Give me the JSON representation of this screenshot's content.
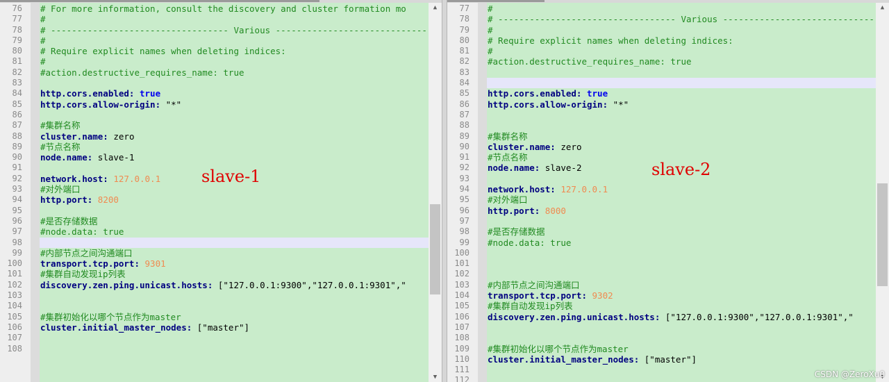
{
  "left_pane": {
    "annotation": "slave-1",
    "lines": [
      {
        "n": "76",
        "segs": [
          [
            "comment",
            "# For more information, consult the discovery and cluster formation mo"
          ]
        ]
      },
      {
        "n": "77",
        "segs": [
          [
            "comment",
            "#"
          ]
        ]
      },
      {
        "n": "78",
        "segs": [
          [
            "comment",
            "# ---------------------------------- Various -----------------------------------"
          ]
        ]
      },
      {
        "n": "79",
        "segs": [
          [
            "comment",
            "#"
          ]
        ]
      },
      {
        "n": "80",
        "segs": [
          [
            "comment",
            "# Require explicit names when deleting indices:"
          ]
        ]
      },
      {
        "n": "81",
        "segs": [
          [
            "comment",
            "#"
          ]
        ]
      },
      {
        "n": "82",
        "segs": [
          [
            "comment",
            "#action.destructive_requires_name: true"
          ]
        ]
      },
      {
        "n": "83",
        "segs": []
      },
      {
        "n": "84",
        "segs": [
          [
            "key",
            "http.cors.enabled:"
          ],
          [
            "plain",
            " "
          ],
          [
            "bool",
            "true"
          ]
        ]
      },
      {
        "n": "85",
        "segs": [
          [
            "key",
            "http.cors.allow-origin:"
          ],
          [
            "str",
            " \"*\""
          ]
        ]
      },
      {
        "n": "86",
        "segs": []
      },
      {
        "n": "87",
        "segs": [
          [
            "comment",
            "#集群名称"
          ]
        ]
      },
      {
        "n": "88",
        "segs": [
          [
            "key",
            "cluster.name:"
          ],
          [
            "plain",
            " zero"
          ]
        ]
      },
      {
        "n": "89",
        "segs": [
          [
            "comment",
            "#节点名称"
          ]
        ]
      },
      {
        "n": "90",
        "segs": [
          [
            "key",
            "node.name:"
          ],
          [
            "plain",
            " slave-1"
          ]
        ]
      },
      {
        "n": "91",
        "segs": []
      },
      {
        "n": "92",
        "segs": [
          [
            "key",
            "network.host:"
          ],
          [
            "plain",
            " "
          ],
          [
            "num-val",
            "127.0.0.1"
          ]
        ]
      },
      {
        "n": "93",
        "segs": [
          [
            "comment",
            "#对外端口"
          ]
        ]
      },
      {
        "n": "94",
        "segs": [
          [
            "key",
            "http.port:"
          ],
          [
            "plain",
            " "
          ],
          [
            "num-val",
            "8200"
          ]
        ]
      },
      {
        "n": "95",
        "segs": []
      },
      {
        "n": "96",
        "segs": [
          [
            "comment",
            "#是否存储数据"
          ]
        ]
      },
      {
        "n": "97",
        "segs": [
          [
            "comment",
            "#node.data: true"
          ]
        ]
      },
      {
        "n": "98",
        "hl": true,
        "segs": []
      },
      {
        "n": "99",
        "segs": [
          [
            "comment",
            "#内部节点之间沟通端口"
          ]
        ]
      },
      {
        "n": "100",
        "segs": [
          [
            "key",
            "transport.tcp.port:"
          ],
          [
            "plain",
            " "
          ],
          [
            "num-val",
            "9301"
          ]
        ]
      },
      {
        "n": "101",
        "segs": [
          [
            "comment",
            "#集群自动发现ip列表"
          ]
        ]
      },
      {
        "n": "102",
        "segs": [
          [
            "key",
            "discovery.zen.ping.unicast.hosts:"
          ],
          [
            "str",
            " [\"127.0.0.1:9300\",\"127.0.0.1:9301\",\""
          ]
        ]
      },
      {
        "n": "103",
        "segs": []
      },
      {
        "n": "104",
        "segs": []
      },
      {
        "n": "105",
        "segs": [
          [
            "comment",
            "#集群初始化以哪个节点作为master"
          ]
        ]
      },
      {
        "n": "106",
        "segs": [
          [
            "key",
            "cluster.initial_master_nodes:"
          ],
          [
            "str",
            " [\"master\"]"
          ]
        ]
      },
      {
        "n": "107",
        "segs": []
      },
      {
        "n": "108",
        "segs": []
      }
    ]
  },
  "right_pane": {
    "annotation": "slave-2",
    "lines": [
      {
        "n": "77",
        "segs": [
          [
            "comment",
            "#"
          ]
        ]
      },
      {
        "n": "78",
        "segs": [
          [
            "comment",
            "# ---------------------------------- Various -----------------------------------"
          ]
        ]
      },
      {
        "n": "79",
        "segs": [
          [
            "comment",
            "#"
          ]
        ]
      },
      {
        "n": "80",
        "segs": [
          [
            "comment",
            "# Require explicit names when deleting indices:"
          ]
        ]
      },
      {
        "n": "81",
        "segs": [
          [
            "comment",
            "#"
          ]
        ]
      },
      {
        "n": "82",
        "segs": [
          [
            "comment",
            "#action.destructive_requires_name: true"
          ]
        ]
      },
      {
        "n": "83",
        "segs": []
      },
      {
        "n": "84",
        "hl": true,
        "segs": []
      },
      {
        "n": "85",
        "segs": [
          [
            "key",
            "http.cors.enabled:"
          ],
          [
            "plain",
            " "
          ],
          [
            "bool",
            "true"
          ]
        ]
      },
      {
        "n": "86",
        "segs": [
          [
            "key",
            "http.cors.allow-origin:"
          ],
          [
            "str",
            " \"*\""
          ]
        ]
      },
      {
        "n": "87",
        "segs": []
      },
      {
        "n": "88",
        "segs": []
      },
      {
        "n": "89",
        "segs": [
          [
            "comment",
            "#集群名称"
          ]
        ]
      },
      {
        "n": "90",
        "segs": [
          [
            "key",
            "cluster.name:"
          ],
          [
            "plain",
            " zero"
          ]
        ]
      },
      {
        "n": "91",
        "segs": [
          [
            "comment",
            "#节点名称"
          ]
        ]
      },
      {
        "n": "92",
        "segs": [
          [
            "key",
            "node.name:"
          ],
          [
            "plain",
            " slave-2"
          ]
        ]
      },
      {
        "n": "93",
        "segs": []
      },
      {
        "n": "94",
        "segs": [
          [
            "key",
            "network.host:"
          ],
          [
            "plain",
            " "
          ],
          [
            "num-val",
            "127.0.0.1"
          ]
        ]
      },
      {
        "n": "95",
        "segs": [
          [
            "comment",
            "#对外端口"
          ]
        ]
      },
      {
        "n": "96",
        "segs": [
          [
            "key",
            "http.port:"
          ],
          [
            "plain",
            " "
          ],
          [
            "num-val",
            "8000"
          ]
        ]
      },
      {
        "n": "97",
        "segs": []
      },
      {
        "n": "98",
        "segs": [
          [
            "comment",
            "#是否存储数据"
          ]
        ]
      },
      {
        "n": "99",
        "segs": [
          [
            "comment",
            "#node.data: true"
          ]
        ]
      },
      {
        "n": "100",
        "segs": []
      },
      {
        "n": "101",
        "segs": []
      },
      {
        "n": "102",
        "segs": []
      },
      {
        "n": "103",
        "segs": [
          [
            "comment",
            "#内部节点之间沟通端口"
          ]
        ]
      },
      {
        "n": "104",
        "segs": [
          [
            "key",
            "transport.tcp.port:"
          ],
          [
            "plain",
            " "
          ],
          [
            "num-val",
            "9302"
          ]
        ]
      },
      {
        "n": "105",
        "segs": [
          [
            "comment",
            "#集群自动发现ip列表"
          ]
        ]
      },
      {
        "n": "106",
        "segs": [
          [
            "key",
            "discovery.zen.ping.unicast.hosts:"
          ],
          [
            "str",
            " [\"127.0.0.1:9300\",\"127.0.0.1:9301\",\""
          ]
        ]
      },
      {
        "n": "107",
        "segs": []
      },
      {
        "n": "108",
        "segs": []
      },
      {
        "n": "109",
        "segs": [
          [
            "comment",
            "#集群初始化以哪个节点作为master"
          ]
        ]
      },
      {
        "n": "110",
        "segs": [
          [
            "key",
            "cluster.initial_master_nodes:"
          ],
          [
            "str",
            " [\"master\"]"
          ]
        ]
      },
      {
        "n": "111",
        "segs": []
      },
      {
        "n": "112",
        "segs": []
      }
    ]
  },
  "watermark": "CSDN @ZeroXu0",
  "colors": {
    "background": "#c9eccb",
    "comment": "#218a21",
    "key": "#000080",
    "bool": "#0000ee",
    "number": "#f08a50",
    "annotation": "#e00000",
    "highlight_line": "#e6e6fa"
  },
  "icons": {
    "scroll_up": "triangle-up-icon",
    "scroll_down": "triangle-down-icon"
  }
}
